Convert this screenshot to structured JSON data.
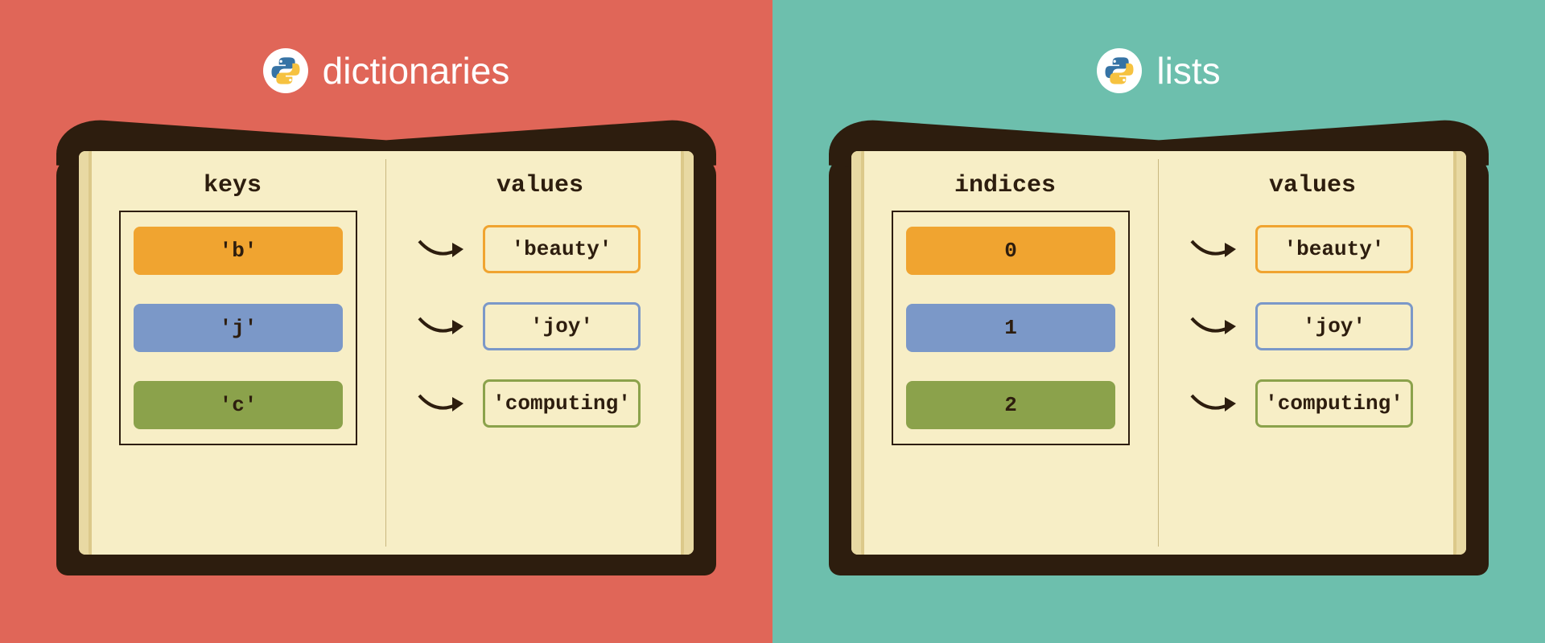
{
  "left": {
    "title": "dictionaries",
    "keys_header": "keys",
    "values_header": "values",
    "rows": [
      {
        "key": "'b'",
        "value": "'beauty'"
      },
      {
        "key": "'j'",
        "value": "'joy'"
      },
      {
        "key": "'c'",
        "value": "'computing'"
      }
    ]
  },
  "right": {
    "title": "lists",
    "keys_header": "indices",
    "values_header": "values",
    "rows": [
      {
        "key": "0",
        "value": "'beauty'"
      },
      {
        "key": "1",
        "value": "'joy'"
      },
      {
        "key": "2",
        "value": "'computing'"
      }
    ]
  },
  "colors": {
    "row0": "orange",
    "row1": "blue",
    "row2": "green"
  }
}
